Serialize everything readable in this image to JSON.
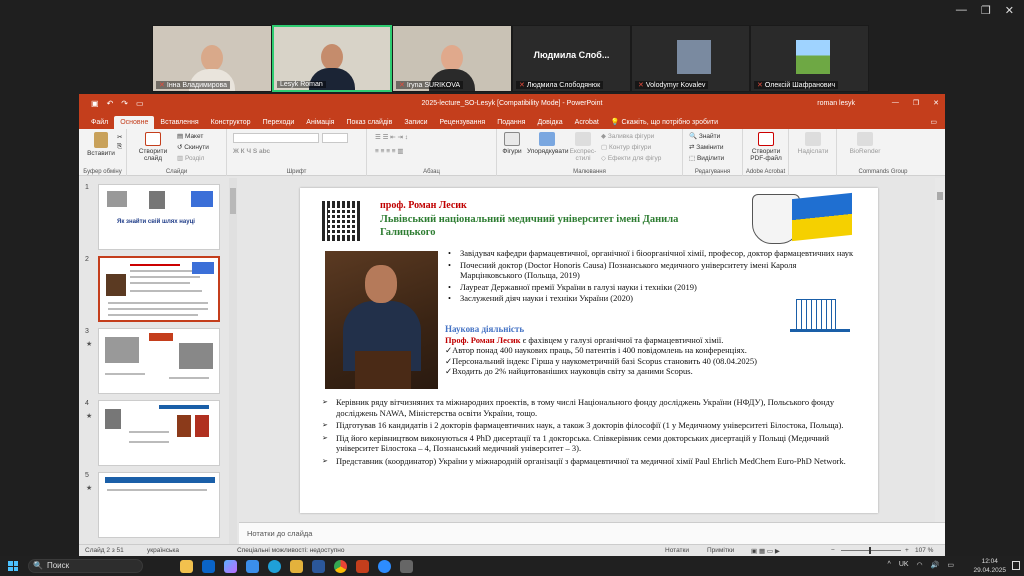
{
  "zoom": {
    "participants": [
      {
        "name": "Інна Владимирова",
        "type": "video",
        "active": false
      },
      {
        "name": "Lesyk Roman",
        "type": "video",
        "active": true
      },
      {
        "name": "Iryna SURIKOVA",
        "type": "video",
        "active": false
      },
      {
        "name": "Людмила Слободянюк",
        "big_label": "Людмила Слоб...",
        "type": "name",
        "active": false
      },
      {
        "name": "Volodymyr Kovalev",
        "type": "avatar",
        "active": false
      },
      {
        "name": "Олексій Шафранович",
        "type": "avatar-landscape",
        "active": false
      }
    ]
  },
  "ppt": {
    "title": "2025-lecture_SO-Lesyk [Compatibility Mode] - PowerPoint",
    "user": "roman lesyk",
    "tabs": [
      "Файл",
      "Основне",
      "Вставлення",
      "Конструктор",
      "Переходи",
      "Анімація",
      "Показ слайдів",
      "Записи",
      "Рецензування",
      "Подання",
      "Довідка",
      "Acrobat"
    ],
    "active_tab": "Основне",
    "tell_me": "Скажіть, що потрібно зробити",
    "ribbon": {
      "paste": "Вставити",
      "clipboard": "Буфер обміну",
      "new_slide": "Створити слайд",
      "layout": "Макет",
      "reset": "Скинути",
      "section": "Розділ",
      "slides": "Слайди",
      "font": "Шрифт",
      "paragraph": "Абзац",
      "shapes": "Фігури",
      "arrange": "Упорядкувати",
      "quick_styles": "Експрес-стилі",
      "shape_fill": "Заливка фігури",
      "shape_outline": "Контур фігури",
      "shape_effects": "Ефекти для фігур",
      "drawing": "Малювання",
      "find": "Знайти",
      "replace": "Замінити",
      "select": "Виділити",
      "editing": "Редагування",
      "create_pdf": "Створити PDF-файл",
      "adobe": "Adobe Acrobat",
      "send": "Надіслати",
      "biorender": "BioRender",
      "commands": "Commands Group"
    },
    "thumbnails": [
      {
        "num": "1",
        "title": "Як знайти свій шлях науці",
        "star": false
      },
      {
        "num": "2",
        "title": "",
        "star": false,
        "selected": true
      },
      {
        "num": "3",
        "title": "",
        "star": true
      },
      {
        "num": "4",
        "title": "",
        "star": true
      },
      {
        "num": "5",
        "title": "",
        "star": true
      }
    ],
    "notes_placeholder": "Нотатки до слайда",
    "status": {
      "slide": "Слайд 2 з 51",
      "lang": "українська",
      "access": "Спеціальні можливості: недоступно",
      "notes": "Нотатки",
      "comments": "Примітки",
      "zoom": "107 %"
    }
  },
  "slide": {
    "name": "проф. Роман Лесик",
    "university": "Львівський національний медичний університет імені Данила Галицького",
    "bullets1": [
      "Завідувач кафедри фармацевтичної, органічної і біоорганічної хімії, професор, доктор фармацевтичних наук",
      "Почесний доктор (Doctor Honoris Causa) Познанського медичного університету імені Кароля Марцінковського (Польща, 2019)",
      "Лауреат Державної премії України в галузі науки і техніки (2019)",
      "Заслужений діяч науки і техніки України (2020)"
    ],
    "sci_heading": "Наукова діяльність",
    "sci_name": "Проф. Роман Лесик",
    "sci_rest": " є фахівцем у галузі органічної та фармацевтичної хімії.",
    "checks": [
      "✓Автор понад 400 наукових праць, 50 патентів і 400 повідомлень на конференціях.",
      "✓Персональний індекс Гірша у наукометричній базі Scopus становить 40 (08.04.2025)",
      "✓Входить до 2% найцитованіших науковців світу за даними Scopus."
    ],
    "bullets2": [
      "Керівник ряду вітчизняних та міжнародних проектів, в тому числі Національного фонду досліджень України (НФДУ), Польського фонду досліджень NAWA, Міністерства освіти України, тощо.",
      "Підготував 16 кандидатів і 2 докторів фармацевтичних наук, а також 3 докторів філософії (1 у Медичному університеті Білостока, Польща).",
      "Під його керівництвом виконуються 4 PhD дисертації та 1 докторська. Співкерівник семи докторських дисертацій у Польщі (Медичний університет Білостока – 4, Познанський медичний університет – 3).",
      "Представник (координатор) України у міжнародній організації з фармацевтичної та медичної хімії Paul Ehrlich MedChem Euro-PhD Network."
    ]
  },
  "taskbar": {
    "search": "Поиск",
    "lang": "UK",
    "time": "12:04",
    "date": "29.04.2025"
  },
  "colors": {
    "ppt_accent": "#c43e1c",
    "slide_name": "#c00000",
    "slide_univ": "#2e7d32",
    "sci_heading": "#4472c4"
  }
}
